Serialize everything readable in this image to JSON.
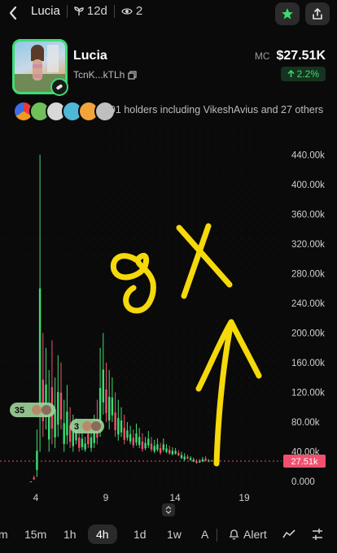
{
  "header": {
    "title": "Lucia",
    "age": "12d",
    "watchers": "2"
  },
  "token": {
    "name": "Lucia",
    "address": "TcnK...kTLh",
    "mc_label": "MC",
    "market_cap": "$27.51K",
    "change": "2.2%"
  },
  "holders": {
    "text": "991 holders including VikeshAvius and 27 others"
  },
  "chart_data": {
    "type": "line",
    "ylim": [
      0,
      460000
    ],
    "y_ticks": [
      "0.000",
      "40.00k",
      "80.00k",
      "120.00k",
      "160.00k",
      "200.00k",
      "240.00k",
      "280.00k",
      "320.00k",
      "360.00k",
      "400.00k",
      "440.00k"
    ],
    "x_ticks": [
      "4",
      "9",
      "14",
      "19"
    ],
    "current_price_label": "27.51k",
    "annotation": "8X",
    "markers": [
      "35",
      "3"
    ],
    "colors": {
      "up": "#3ddc73",
      "down": "#f0506e",
      "annotation": "#f5d90a"
    }
  },
  "timeframes": [
    "m",
    "15m",
    "1h",
    "4h",
    "1d",
    "1w",
    "A"
  ],
  "active_timeframe": "4h",
  "alert_label": "Alert"
}
